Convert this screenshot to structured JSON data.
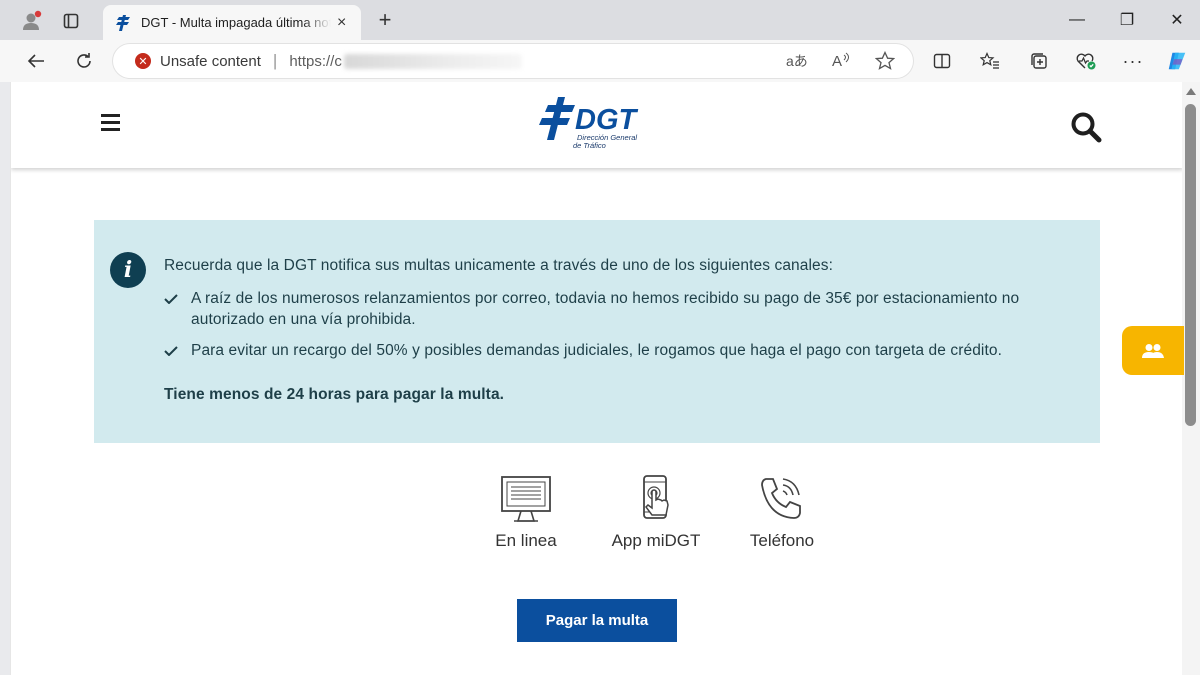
{
  "browser": {
    "tab": {
      "title": "DGT - Multa impagada última notificación",
      "close_icon": "×"
    },
    "new_tab_icon": "+",
    "window_controls": {
      "minimize": "—",
      "restore": "❐",
      "close": "✕"
    },
    "address_bar": {
      "security_label": "Unsafe content",
      "url_visible": "https://c",
      "separator": "|"
    },
    "toolbar_icons": [
      "read-aloud-icon",
      "favorite-icon",
      "split-screen-icon",
      "favorites-list-icon",
      "collections-icon",
      "browser-essentials-icon",
      "more-icon",
      "copilot-icon"
    ],
    "colors": {
      "tabbar": "#dcdde1",
      "warning": "#c42b1c"
    }
  },
  "site": {
    "logo_text": "DGT",
    "logo_sub1": "Dirección General",
    "logo_sub2": "de Tráfico",
    "alert": {
      "intro": "Recuerda que la DGT notifica sus multas unicamente a través de uno de los siguientes canales:",
      "items": [
        "A raíz de los numerosos relanzamientos por correo, todavia no hemos recibido su pago de 35€ por estacionamiento no autorizado en una vía prohibida.",
        "Para evitar un recargo del 50% y posibles demandas judiciales, le rogamos que haga el pago con targeta de crédito."
      ],
      "deadline": "Tiene menos de 24 horas para pagar la multa."
    },
    "channels": [
      {
        "label": "En linea",
        "icon": "monitor-icon"
      },
      {
        "label": "App miDGT",
        "icon": "mobile-touch-icon"
      },
      {
        "label": "Teléfono",
        "icon": "phone-icon"
      }
    ],
    "pay_button": "Pagar la multa",
    "colors": {
      "alert_bg": "#d2eaee",
      "brand_blue": "#0b4f9e",
      "side_tab": "#f7b500",
      "info_icon": "#0f3f52"
    }
  }
}
